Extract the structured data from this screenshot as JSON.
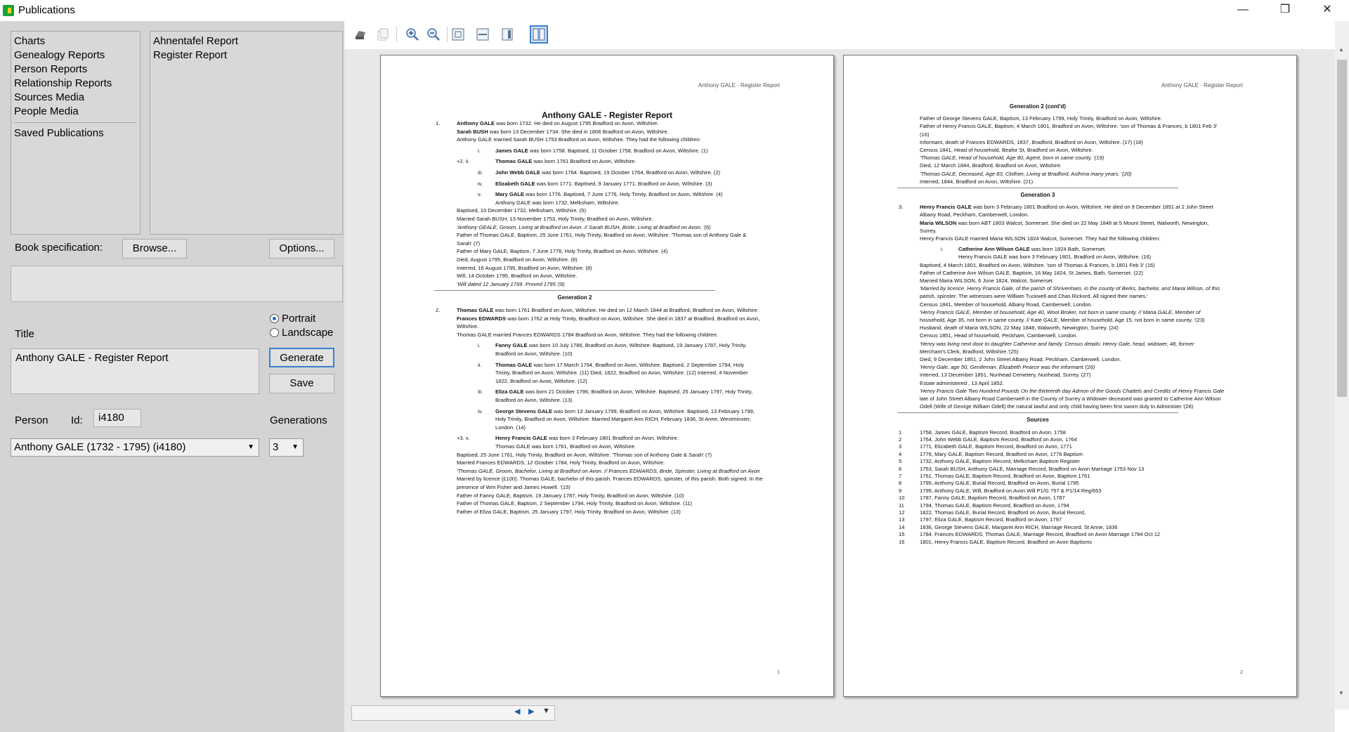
{
  "window": {
    "title": "Publications",
    "controls": {
      "minimize": "—",
      "maximize": "❐",
      "close": "✕"
    }
  },
  "categories": [
    "Charts",
    "Genealogy Reports",
    "Person Reports",
    "Relationship Reports",
    "Sources Media",
    "People Media"
  ],
  "saved_publications": "Saved Publications",
  "reports": [
    "Ahnentafel Report",
    "Register Report"
  ],
  "book_spec": {
    "label": "Book specification:",
    "browse": "Browse...",
    "options": "Options..."
  },
  "orientation": {
    "portrait": "Portrait",
    "landscape": "Landscape",
    "selected": "Portrait"
  },
  "title_label": "Title",
  "title_value": "Anthony GALE - Register Report",
  "generate": "Generate",
  "save": "Save",
  "person": {
    "label": "Person",
    "id_label": "Id:",
    "id_value": "i4180",
    "selected": "Anthony GALE  (1732 - 1795)  (i4180)"
  },
  "generations": {
    "label": "Generations",
    "value": "3"
  },
  "toolbar_icons": [
    "print-icon",
    "copy-icon",
    "zoom-in-icon",
    "zoom-out-icon",
    "fit-page-icon",
    "fit-width-icon",
    "single-page-icon",
    "two-page-icon"
  ],
  "page1": {
    "header": "Anthony GALE - Register Report",
    "title": "Anthony GALE - Register Report",
    "number": "1",
    "lines": [
      [
        "1.",
        "Anthony GALE was born 1732. He died on August 1795 Bradford on Avon, Wiltshire."
      ],
      [
        "",
        "Sarah BUSH was born 13 December 1734. She died in 1806 Bradford on Avon, Wiltshire."
      ],
      [
        "",
        "Anthony GALE married Sarah BUSH 1753 Bradford on Avon, Wiltshire. They had the following children:"
      ],
      [
        "i.",
        "James GALE  was born 1758.    Baptised, 11 October 1758, Bradford on Avon, Wiltshire. (1)"
      ],
      [
        "+2.   ii.",
        "Thomas GALE was born 1761 Bradford on Avon, Wiltshire."
      ],
      [
        "iii.",
        "John Webb GALE  was born 1764.    Baptised, 19 October 1764, Bradford on Avon, Wiltshire. (2)"
      ],
      [
        "iv.",
        "Elizabeth GALE  was born 1771.    Baptised, 9 January 1771, Bradford on Avon, Wiltshire. (3)"
      ],
      [
        "v.",
        "Mary GALE  was born 1776.    Baptised, 7 June 1776, Holy Trinity, Bradford on Avon, Wiltshire. (4)"
      ],
      [
        "",
        "Anthony GALE was born 1732, Melksham, Wiltshire."
      ],
      [
        "",
        "Baptised, 10 December 1732, Melksham, Wiltshire. (5)"
      ],
      [
        "",
        "Married Sarah BUSH, 13 November 1753, Holy Trinity, Bradford on Avon, Wiltshire."
      ],
      [
        "",
        "'Anthony GEALE, Groom, Living at Bradford on Avon.  // Sarah BUSH, Bride, Living at Bradford on Avon. '(6)"
      ],
      [
        "",
        "Father of Thomas GALE, Baptism, 25 June 1761, Holy Trinity, Bradford on Avon, Wiltshire. 'Thomas son of Anthony Gale &"
      ],
      [
        "",
        "Sarah' (7)"
      ],
      [
        "",
        "Father of Mary GALE, Baptism, 7 June 1776, Holy Trinity, Bradford on Avon, Wiltshire. (4)"
      ],
      [
        "",
        "Died, August 1795, Bradford on Avon, Wiltshire. (8)"
      ],
      [
        "",
        "Interred, 16 August 1795, Bradford on Avon, Wiltshire. (8)"
      ],
      [
        "",
        "Will, 14 October 1795, Bradford on Avon, Wiltshire."
      ],
      [
        "",
        "'Will dated 12 January 1769. Proved 1795.'(9)"
      ],
      [
        "GEN",
        "Generation 2"
      ],
      [
        "2.",
        "Thomas GALE was born 1761 Bradford on Avon, Wiltshire. He died on 12 March 1844 at Bradford, Bradford on Avon, Wiltshire."
      ],
      [
        "",
        "Frances EDWARDS was born 1762 at Holy Trinity, Bradford on Avon, Wiltshire. She died in 1837 at Bradford, Bradford on Avon,"
      ],
      [
        "",
        "Wiltshire."
      ],
      [
        "",
        "Thomas GALE married Frances EDWARDS 1784 Bradford on Avon, Wiltshire. They had the following children:"
      ],
      [
        "i.",
        "Fanny GALE  was born 10 July 1786, Bradford on Avon, Wiltshire.    Baptised, 19 January 1787, Holy Trinity,"
      ],
      [
        "",
        "Bradford on Avon, Wiltshire. (10)"
      ],
      [
        "ii.",
        "Thomas GALE  was born 17 March 1794, Bradford on Avon, Wiltshire.    Baptised, 2 September 1794, Holy"
      ],
      [
        "",
        "Trinity, Bradford on Avon, Wiltshire. (11)    Died, 1822, Bradford on Avon, Wiltshire. (12)    Interred, 4 November"
      ],
      [
        "",
        "1822, Bradford on Avon, Wiltshire. (12)"
      ],
      [
        "iii.",
        "Eliza GALE  was born 21 October 1796, Bradford on Avon, Wiltshire.    Baptised, 25 January 1797, Holy Trinity,"
      ],
      [
        "",
        "Bradford on Avon, Wiltshire. (13)"
      ],
      [
        "iv.",
        "George Stevens GALE  was born 13 January 1799, Bradford on Avon, Wiltshire.    Baptised, 13 February 1799,"
      ],
      [
        "",
        "Holy Trinity, Bradford on Avon, Wiltshire.    Married Margaret Ann RICH, February 1836, St Anne, Westminster,"
      ],
      [
        "",
        "London. (14)"
      ],
      [
        "+3.   v.",
        "Henry Francis GALE was born 3 February 1801 Bradford on Avon, Wiltshire."
      ],
      [
        "",
        "Thomas GALE was born 1761, Bradford on Avon, Wiltshire."
      ],
      [
        "",
        "Baptised, 25 June 1761, Holy Trinity, Bradford on Avon, Wiltshire. 'Thomas son of Anthony Gale & Sarah' (7)"
      ],
      [
        "",
        "Married Frances EDWARDS, 12 October 1784, Holy Trinity, Bradford on Avon, Wiltshire."
      ],
      [
        "",
        "'Thomas GALE, Groom, Bachelor, Living at Bradford on Avon.  // Frances EDWARDS, Bride, Spinster, Living at Bradford on Avon"
      ],
      [
        "",
        "Married by licence (£100). Thomas GALE, bachelor of this parish. Frances EDWARDS, spinster, of this parish. Both signed. In the"
      ],
      [
        "",
        "presence of Wm Fisher and James Howell. '(15)"
      ],
      [
        "",
        "Father of Fanny GALE, Baptism, 19 January 1787, Holy Trinity, Bradford on Avon, Wiltshire. (10)"
      ],
      [
        "",
        "Father of Thomas GALE, Baptism, 2 September 1794, Holy Trinity, Bradford on Avon, Wiltshire. (11)"
      ],
      [
        "",
        "Father of Eliza GALE, Baptism, 25 January 1797, Holy Trinity, Bradford on Avon, Wiltshire. (13)"
      ]
    ]
  },
  "page2": {
    "header": "Anthony GALE - Register Report",
    "number": "2",
    "lines": [
      [
        "GEN",
        "Generation 2 (cont'd)"
      ],
      [
        "",
        "Father of George Stevens GALE, Baptism, 13 February 1799, Holy Trinity, Bradford on Avon, Wiltshire."
      ],
      [
        "",
        "Father of Henry Francis GALE, Baptism, 4 March 1801, Bradford on Avon, Wiltshire. 'son of Thomas & Frances, b 1801 Feb 3'"
      ],
      [
        "",
        "(16)"
      ],
      [
        "",
        "Informant, death of Frances EDWARDS, 1837, Bradford, Bradford on Avon, Wiltshire. (17) (18)"
      ],
      [
        "",
        "Census 1841, Head of household, Beafor St, Bradford on Avon, Wiltshire."
      ],
      [
        "",
        "'Thomas GALE, Head of household, Age 80, Agent, born in same county. '(19)"
      ],
      [
        "",
        "Died, 12 March 1844, Bradford, Bradford on Avon, Wiltshire."
      ],
      [
        "",
        "'Thomas GALE, Deceased, Age 83, Clothier, Living at Bradford, Asthma many years. '(20)"
      ],
      [
        "",
        "Interred, 1844, Bradford on Avon, Wiltshire. (21)"
      ],
      [
        "GEN",
        "Generation 3"
      ],
      [
        "3.",
        "Henry Francis GALE was born 3 February 1801 Bradford on Avon, Wiltshire. He died on 9 December 1851 at 2 John Street"
      ],
      [
        "",
        "Albany Road, Peckham, Camberwell, London."
      ],
      [
        "",
        "Maria WILSON was born ABT 1803 Walcot, Somerset. She died on 22 May 1848 at 5 Mount Street, Walworth, Newington,"
      ],
      [
        "",
        "Surrey."
      ],
      [
        "",
        "Henry Francis GALE married Maria WILSON 1824 Walcot, Somerset. They had the following children:"
      ],
      [
        "i.",
        "Catherine Ann Wilson GALE was born 1824 Bath, Somerset."
      ],
      [
        "",
        "Henry Francis GALE was born 3 February 1801, Bradford on Avon, Wiltshire. (16)"
      ],
      [
        "",
        "Baptised, 4 March 1801, Bradford on Avon, Wiltshire. 'son of Thomas & Frances, b 1801 Feb 3' (16)"
      ],
      [
        "",
        "Father of Catherine Ann Wilson GALE, Baptism, 16 May 1824, St James, Bath, Somerset. (22)"
      ],
      [
        "",
        "Married Maria WILSON, 6 June 1824, Walcot, Somerset."
      ],
      [
        "",
        "'Married by licence. Henry Francis Gale, of the parish of Shrivenham, in the county of Berks, bachelor, and Maria Wilson, of this"
      ],
      [
        "",
        "parish, spinster. The witnesses were William Tuckwell and Chas Rickord. All signed their names.'"
      ],
      [
        "",
        "Census 1841, Member of household, Albany Road, Camberwell, London."
      ],
      [
        "",
        "'Henry Francis GALE, Member of household, Age 40, Wool Broker, not born in same county.  // Maria GALE, Member of"
      ],
      [
        "",
        "household, Age 35, not born in same county.  // Kate GALE, Member of household, Age 15, not born in same county. '(23)"
      ],
      [
        "",
        "Husband, death of Maria WILSON, 22 May 1848, Walworth, Newington, Surrey. (24)"
      ],
      [
        "",
        "Census 1851, Head of household, Peckham, Camberwell, London."
      ],
      [
        "",
        "'Henry was living next door to daughter Catherine and family. Census details: Henry Gale, head, widower, 48, former"
      ],
      [
        "",
        "Merchant's Clerk, Bradford, Wiltshire.'(25)"
      ],
      [
        "",
        "Died, 9 December 1851, 2 John Street Albany Road, Peckham, Camberwell, London."
      ],
      [
        "",
        "'Henry Gale, age 50, Gentleman. Elizabeth Pearce was the informant.'(26)"
      ],
      [
        "",
        "Interred, 13 December 1851, Nunhead Cemetery, Nunhead, Surrey. (27)"
      ],
      [
        "",
        "Estate administered , 13 April 1852."
      ],
      [
        "",
        "'Henry Francis Gale Two Hundred Pounds On the thirteenth day Admon of the Goods Chattels and Credits of Henry Francis Gale"
      ],
      [
        "",
        "late of John Street Albany Road Camberwell in the County of Surrey a Widower deceased was granted to Catherine Ann Wilson"
      ],
      [
        "",
        "Odell (Wife of George William Odell) the natural lawful and only child having been first sworn duly to Administer.'(28)"
      ],
      [
        "GEN",
        "Sources"
      ]
    ],
    "sources": [
      [
        "1",
        "1758, James GALE, Baptism Record, Bradford on Avon, 1758"
      ],
      [
        "2",
        "1764, John Webb GALE, Baptism Record, Bradford on Avon, 1764"
      ],
      [
        "3",
        "1771, Elizabeth GALE, Baptism Record, Bradford on Avon, 1771"
      ],
      [
        "4",
        "1776, Mary GALE, Baptism Record, Bradford on Avon, 1776 Baptism"
      ],
      [
        "5",
        "1732, Anthony GALE, Baptism Record, Melksham Baptism Register"
      ],
      [
        "6",
        "1753, Sarah BUSH, Anthony GALE, Marriage Record, Bradford on Avon Marriage 1753 Nov 13"
      ],
      [
        "7",
        "1761, Thomas GALE, Baptism Record, Bradford on Avon, Baptism 1761"
      ],
      [
        "8",
        "1795, Anthony GALE, Burial Record, Bradford on Avon, Burial 1795"
      ],
      [
        "9",
        "1795, Anthony GALE, Will, Bradford on Avon Will P1/G 757 & P1/14 Reg/653"
      ],
      [
        "10",
        "1787, Fanny GALE, Baptism Record, Bradford on Avon, 1787"
      ],
      [
        "11",
        "1794, Thomas GALE, Baptism Record, Bradford on Avon, 1794"
      ],
      [
        "12",
        "1822, Thomas GALE, Burial Record, Bradford on Avon, Burial Record,"
      ],
      [
        "13",
        "1797, Eliza GALE, Baptism Record, Bradford on Avon, 1797"
      ],
      [
        "14",
        "1836, George Stevens GALE, Margaret Ann RICH, Marriage Record, St Anne, 1836"
      ],
      [
        "15",
        "1784, Frances EDWARDS, Thomas GALE, Marriage Record, Bradford on Avon Marriage 1784 Oct 12"
      ],
      [
        "16",
        "1801, Henry Francis GALE, Baptism Record, Bradford on Avon Baptisms"
      ]
    ]
  },
  "statusbar": {
    "prev": "◀",
    "next": "▶",
    "menu": "▼"
  }
}
